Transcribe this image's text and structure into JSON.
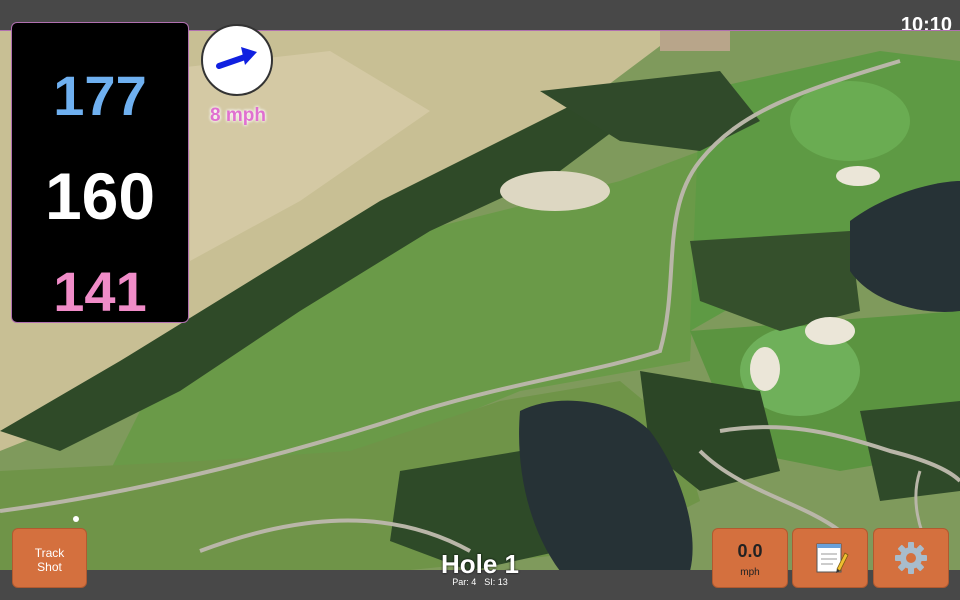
{
  "status": {
    "time": "10:10"
  },
  "distances": {
    "back": "177",
    "middle": "160",
    "front": "141"
  },
  "wind": {
    "speed_label": "8 mph",
    "icon": "arrow-right-icon"
  },
  "hole": {
    "title": "Hole 1",
    "par": "Par: 4",
    "si": "SI: 13"
  },
  "buttons": {
    "track_line1": "Track",
    "track_line2": "Shot",
    "speed_value": "0.0",
    "speed_unit": "mph",
    "notes_icon": "notepad-icon",
    "settings_icon": "gear-icon"
  },
  "colors": {
    "back": "#6fb0f0",
    "middle": "#ffffff",
    "front": "#f08cc8",
    "button": "#d4703e",
    "wind_label": "#e070d0"
  }
}
